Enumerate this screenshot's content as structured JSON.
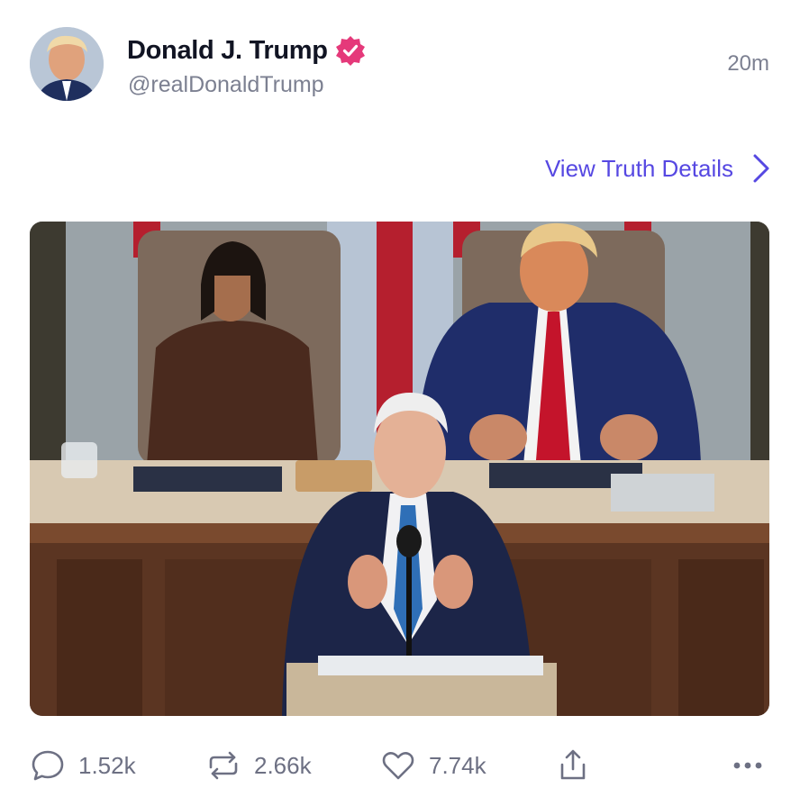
{
  "post": {
    "author": {
      "display_name": "Donald J. Trump",
      "handle": "@realDonaldTrump",
      "verified": true
    },
    "timestamp": "20m",
    "details_link": "View Truth Details"
  },
  "actions": {
    "replies": "1.52k",
    "retruths": "2.66k",
    "likes": "7.74k"
  },
  "icons": {
    "verified": "verified-badge-icon",
    "details": "chevron-right-icon",
    "reply": "comment-bubble-icon",
    "retruth": "repost-arrows-icon",
    "like": "heart-icon",
    "share": "share-upload-icon",
    "more": "more-dots-icon"
  },
  "colors": {
    "accent": "#5648e2",
    "verified": "#e5397a",
    "muted": "#7c8091",
    "text": "#111423"
  }
}
